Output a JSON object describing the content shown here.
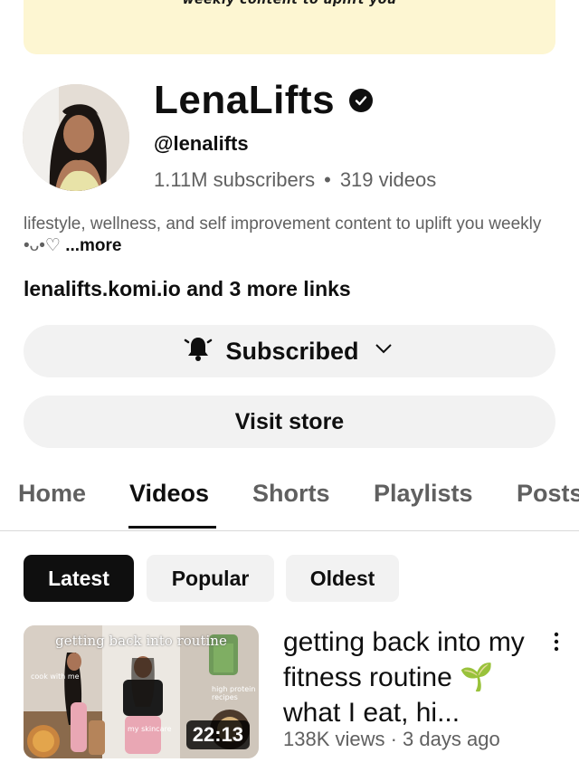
{
  "banner": {
    "text": "weekly content to uplift you"
  },
  "channel": {
    "name": "LenaLifts",
    "handle": "@lenalifts",
    "subscribers": "1.11M subscribers",
    "separator": "•",
    "videos_count": "319 videos",
    "description": "lifestyle, wellness, and self improvement content to uplift you weekly •ᴗ•♡ ",
    "description_more": "...more",
    "links": "lenalifts.komi.io and 3 more links"
  },
  "buttons": {
    "subscribed_label": "Subscribed",
    "store_label": "Visit store"
  },
  "tabs": [
    {
      "label": "Home"
    },
    {
      "label": "Videos"
    },
    {
      "label": "Shorts"
    },
    {
      "label": "Playlists"
    },
    {
      "label": "Posts"
    }
  ],
  "active_tab": "Videos",
  "filters": [
    {
      "label": "Latest"
    },
    {
      "label": "Popular"
    },
    {
      "label": "Oldest"
    }
  ],
  "active_filter": "Latest",
  "video": {
    "thumbnail_title": "getting back into routine",
    "thumbnail_small_left": "cook with me",
    "thumbnail_small_mid": "my skincare",
    "thumbnail_small_right": "high protein recipes",
    "duration": "22:13",
    "title": "getting back into my fitness routine 🌱 what I eat, hi...",
    "meta": "138K views · 3 days ago"
  },
  "colors": {
    "text_primary": "#0f0f0f",
    "text_secondary": "#606060",
    "chip_bg": "#f2f2f2",
    "banner_bg": "#fdf6d2"
  }
}
